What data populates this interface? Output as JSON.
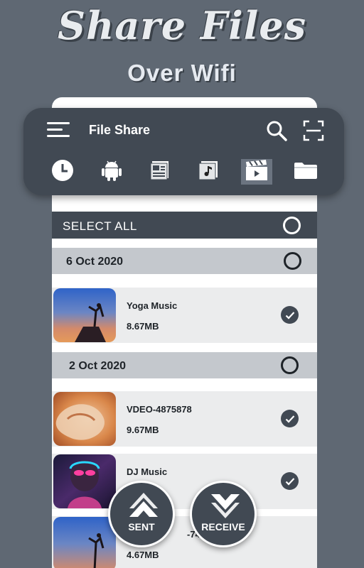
{
  "promo": {
    "title": "Share Files",
    "subtitle": "Over Wifi"
  },
  "toolbar": {
    "title": "File Share",
    "icons": [
      "menu-icon",
      "search-icon",
      "scan-icon"
    ],
    "tabs": [
      {
        "icon": "clock-icon",
        "active": false
      },
      {
        "icon": "android-icon",
        "active": false
      },
      {
        "icon": "document-icon",
        "active": false
      },
      {
        "icon": "music-icon",
        "active": false
      },
      {
        "icon": "video-icon",
        "active": true
      },
      {
        "icon": "folder-icon",
        "active": false
      }
    ]
  },
  "list": {
    "select_all_label": "SELECT ALL",
    "groups": [
      {
        "date": "6 Oct 2020",
        "files": [
          {
            "name": "Yoga Music",
            "size": "8.67MB",
            "checked": true
          }
        ]
      },
      {
        "date": "2 Oct 2020",
        "files": [
          {
            "name": "VDEO-4875878",
            "size": "9.67MB",
            "checked": true
          },
          {
            "name": "DJ Music",
            "size": "",
            "checked": true
          },
          {
            "name": "-74353",
            "size": "4.67MB",
            "checked": false
          }
        ]
      }
    ]
  },
  "actions": {
    "sent_label": "SENT",
    "receive_label": "RECEIVE"
  },
  "colors": {
    "background": "#5f6873",
    "toolbar": "#414953",
    "date_row": "#c4c8cd",
    "file_row": "#ebeced"
  }
}
